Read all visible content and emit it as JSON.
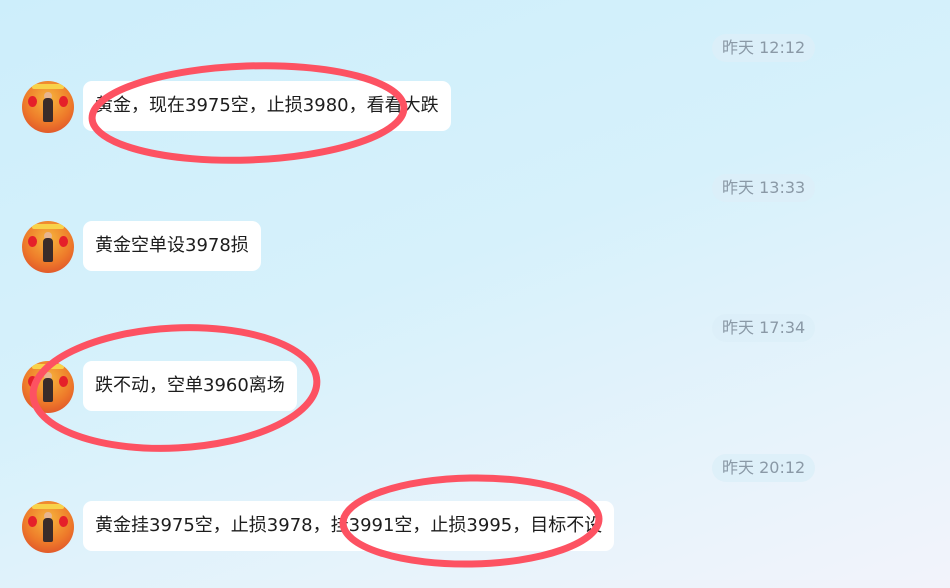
{
  "messages": [
    {
      "time": "昨天 12:12",
      "text": "黄金，现在3975空，止损3980，看看大跌"
    },
    {
      "time": "昨天 13:33",
      "text": "黄金空单设3978损"
    },
    {
      "time": "昨天 17:34",
      "text": "跌不动，空单3960离场"
    },
    {
      "time": "昨天 20:12",
      "text": "黄金挂3975空，止损3978，挂3991空，止损3995，目标不设"
    }
  ],
  "colors": {
    "highlight_circle": "#fd5262",
    "bubble_bg": "#ffffff",
    "time_text": "#8a99a6"
  },
  "icons": {
    "avatar": "user-avatar-image"
  }
}
